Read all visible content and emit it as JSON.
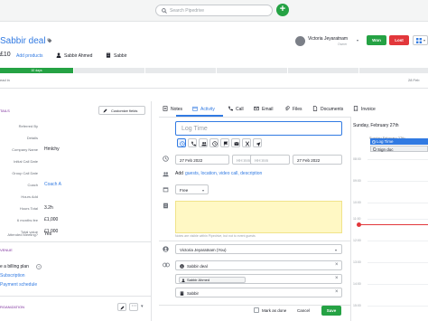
{
  "topbar": {
    "search_placeholder": "Search Pipedrive",
    "add_label": "+"
  },
  "deal": {
    "title": "Sabbir deal",
    "value": "£10",
    "add_products": "Add products",
    "person": "Sabbir Ahmed",
    "organization": "Sabbir",
    "owner_name": "Victoria Jeyaratnam",
    "owner_role": "Owner",
    "won_label": "Won",
    "lost_label": "Lost"
  },
  "pipeline": {
    "stage_days": "10 days",
    "created_label": "ead in",
    "right_date": "28 Feb"
  },
  "details": {
    "section_title": "TAILS",
    "customize_label": "Customize fields",
    "fields": [
      {
        "label": "Referred By",
        "value": ""
      },
      {
        "label": "Details",
        "value": ""
      },
      {
        "label": "Company Name",
        "value": "Hmlchy"
      },
      {
        "label": "Initial Call Date",
        "value": ""
      },
      {
        "label": "Group Call Date",
        "value": ""
      },
      {
        "label": "Coach",
        "value": "Coach A"
      },
      {
        "label": "Hours Add",
        "value": ""
      },
      {
        "label": "Hours Total",
        "value": "3.2h"
      },
      {
        "label": "6 months fee",
        "value": "£1,000"
      },
      {
        "label": "Total value",
        "value": "£1,000"
      },
      {
        "label": "Attended Meeting?",
        "value": "Yes"
      }
    ]
  },
  "revenue": {
    "section_title": "VENUE",
    "billing_text": "e a billing plan",
    "subscription": "Subscription",
    "payment_schedule": "Payment schedule"
  },
  "organization_section": {
    "title": "RGANIZATION"
  },
  "tabs": [
    {
      "label": "Notes",
      "icon": "notes-icon"
    },
    {
      "label": "Activity",
      "icon": "calendar-icon"
    },
    {
      "label": "Call",
      "icon": "phone-icon"
    },
    {
      "label": "Email",
      "icon": "email-icon"
    },
    {
      "label": "Files",
      "icon": "paperclip-icon"
    },
    {
      "label": "Documents",
      "icon": "document-icon"
    },
    {
      "label": "Invoice",
      "icon": "invoice-icon"
    }
  ],
  "activity": {
    "subject_placeholder": "Log Time",
    "start_date": "27 Feb 2022",
    "start_time_placeholder": "HH:mm",
    "end_time_placeholder": "HH:mm",
    "end_date": "27 Feb 2022",
    "add_prefix": "Add",
    "add_links": "guests, location, video call, description",
    "busy_value": "Free",
    "notes_help": "Notes are visible within Pipedrive, but not to event guests",
    "assignee": "Victoria Jeyaratnam (You)",
    "deal_chip": "Sabbir deal",
    "person_chip": "Sabbir Ahmed",
    "org_chip": "Sabbir",
    "mark_done": "Mark as done",
    "cancel": "Cancel",
    "save": "Save"
  },
  "calendar": {
    "header": "Sunday, February 27th",
    "subheader": "Sunday February 27th",
    "events": [
      "Log Time",
      "Sign doc"
    ],
    "hours": [
      "08:00",
      "09:00",
      "10:00",
      "11:00",
      "12:00",
      "13:00",
      "14:00",
      "15:00"
    ]
  }
}
